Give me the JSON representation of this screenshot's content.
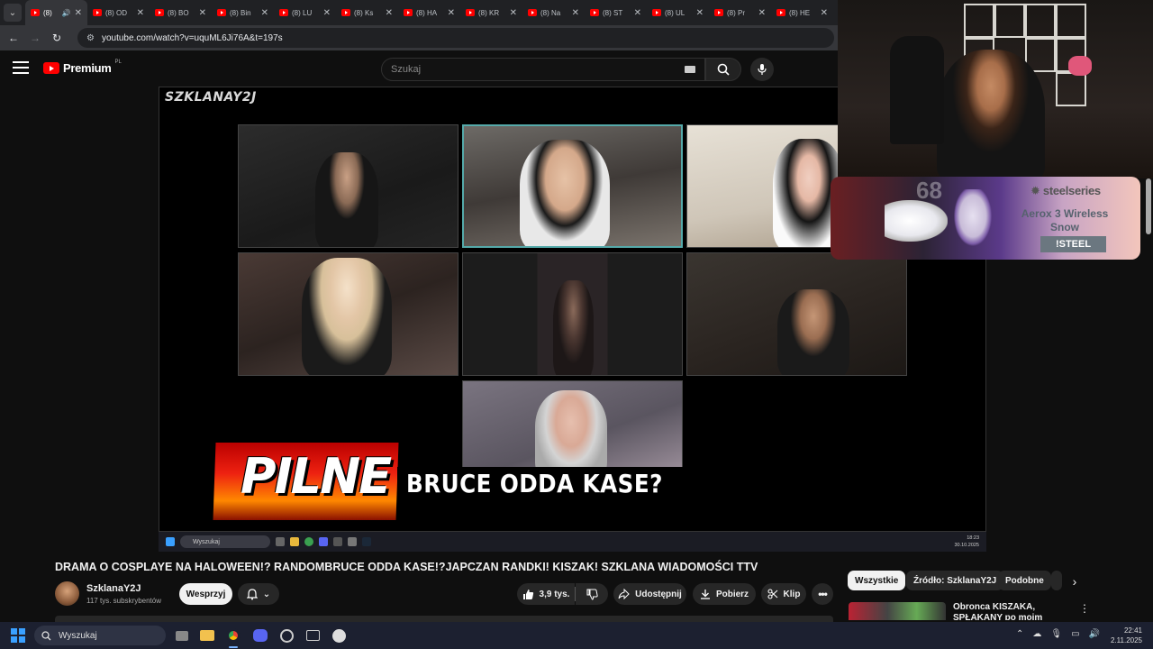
{
  "browser": {
    "tabs": [
      {
        "label": "(8)",
        "active": true
      },
      {
        "label": "(8) OD"
      },
      {
        "label": "(8) BO"
      },
      {
        "label": "(8) Bin"
      },
      {
        "label": "(8) LU"
      },
      {
        "label": "(8) Ks"
      },
      {
        "label": "(8) HA"
      },
      {
        "label": "(8) KR"
      },
      {
        "label": "(8) Na"
      },
      {
        "label": "(8) ST"
      },
      {
        "label": "(8) UL"
      },
      {
        "label": "(8) Pr"
      },
      {
        "label": "(8) HE"
      }
    ],
    "url": "youtube.com/watch?v=uquML6Ji76A&t=197s"
  },
  "youtube": {
    "logo_text": "Premium",
    "logo_region": "PL",
    "search_placeholder": "Szukaj"
  },
  "video": {
    "watermark": "SZKLANAY2J",
    "banner_label": "PILNE",
    "ticker_text": "BRUCE ODDA KASE?",
    "inner_taskbar": {
      "search_placeholder": "Wyszukaj",
      "time": "18:23",
      "date": "30.10.2025"
    }
  },
  "info": {
    "title": "DRAMA O COSPLAYE NA HALOWEEN!? RANDOMBRUCE ODDA KASE!?JAPCZAN RANDKI! KISZAK! SZKLANA WIADOMOŚCI TTV",
    "channel": "SzklanaY2J",
    "subscribers": "117 tys. subskrybentów",
    "support_label": "Wesprzyj",
    "likes": "3,9 tys.",
    "share_label": "Udostępnij",
    "download_label": "Pobierz",
    "clip_label": "Klip"
  },
  "sidebar": {
    "chips": [
      "Wszystkie",
      "Źródło: SzklanaY2J",
      "Podobne"
    ],
    "recommendation_title": "Obronca KISZAKA, SPŁAKANY po moim FILMIE 😂"
  },
  "overlay": {
    "ad_brand": "steelseries",
    "ad_product": "Aerox 3 Wireless Snow",
    "ad_cta": "!STEEL",
    "ad_number": "68"
  },
  "taskbar": {
    "search_placeholder": "Wyszukaj",
    "time": "22:41",
    "date": "2.11.2025"
  }
}
